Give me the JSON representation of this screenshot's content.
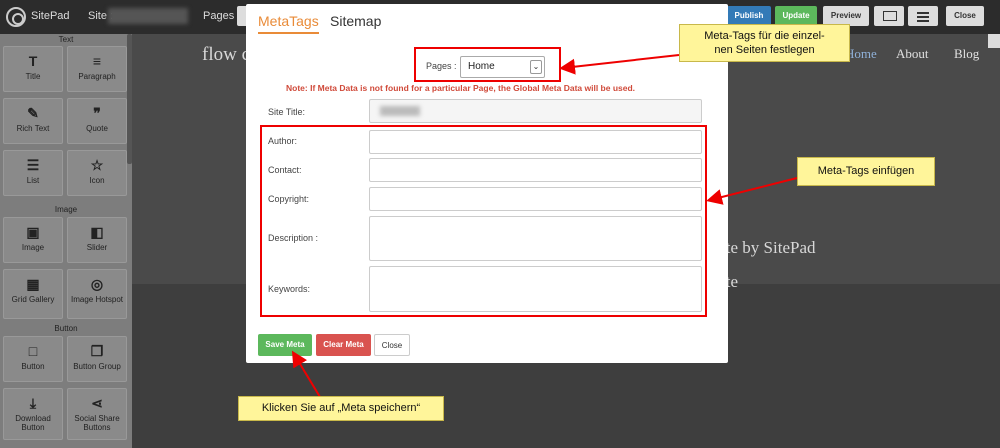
{
  "topbar": {
    "brand": "SitePad",
    "site_label": "Site :",
    "pages_label": "Pages :",
    "publish": "Publish",
    "update": "Update",
    "preview": "Preview",
    "close": "Close"
  },
  "sidebar": {
    "section_text": "Text",
    "section_image": "Image",
    "section_button": "Button",
    "widgets": {
      "title": "Title",
      "paragraph": "Paragraph",
      "rich_text": "Rich Text",
      "quote": "Quote",
      "list": "List",
      "icon": "Icon",
      "image": "Image",
      "slider": "Slider",
      "grid_gallery": "Grid Gallery",
      "image_hotspot": "Image Hotspot",
      "button": "Button",
      "button_group": "Button Group",
      "download_button": "Download Button",
      "social_share": "Social Share Buttons"
    },
    "icons": {
      "title": "T",
      "paragraph": "≡",
      "rich_text": "✎",
      "quote": "❞",
      "list": "☰",
      "icon": "☆",
      "image": "▣",
      "slider": "◧",
      "grid_gallery": "▦",
      "image_hotspot": "◎",
      "button": "□",
      "button_group": "❐",
      "download_button": "⤓",
      "social_share": "⋖"
    }
  },
  "background": {
    "logo_text": "flow c",
    "nav_home": "Home",
    "nav_about": "About",
    "nav_blog": "Blog",
    "line1": "plate by SitePad",
    "line2": "plate"
  },
  "modal": {
    "tab_metatags": "MetaTags",
    "tab_sitemap": "Sitemap",
    "pages_label": "Pages :",
    "pages_value": "Home",
    "note": "Note: If Meta Data is not found for a particular Page, the Global Meta Data will be used.",
    "fields": {
      "site_title": "Site Title:",
      "author": "Author:",
      "contact": "Contact:",
      "copyright": "Copyright:",
      "description": "Description :",
      "keywords": "Keywords:"
    },
    "save": "Save Meta",
    "clear": "Clear Meta",
    "close": "Close"
  },
  "annotations": {
    "callout_pages": "Meta-Tags für die einzel-\nnen Seiten festlegen",
    "callout_insert": "Meta-Tags einfügen",
    "callout_save": "Klicken Sie auf „Meta speichern“"
  },
  "colors": {
    "accent_tab": "#e98b38",
    "save": "#5cb85c",
    "clear": "#d9534f",
    "annotation_red": "#e00000",
    "callout_bg": "#fff59a"
  }
}
